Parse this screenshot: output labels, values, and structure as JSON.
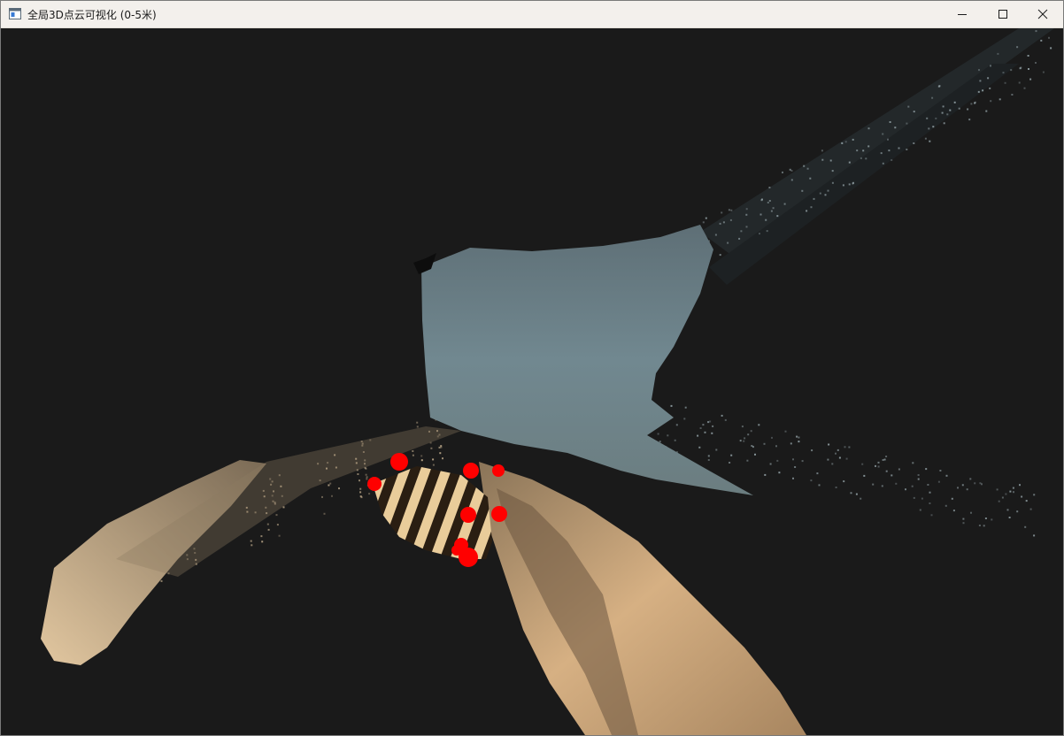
{
  "window": {
    "title": "全局3D点云可视化 (0-5米)",
    "app_icon": "app-window-icon",
    "controls": {
      "minimize": "minimize-icon",
      "maximize": "maximize-icon",
      "close": "close-icon"
    }
  },
  "viewport": {
    "background_color": "#1a1a1a",
    "wall_color": "#6e8188",
    "floor_color": "#b9946a",
    "marker_color": "#ff0000",
    "marker_count": 9
  }
}
